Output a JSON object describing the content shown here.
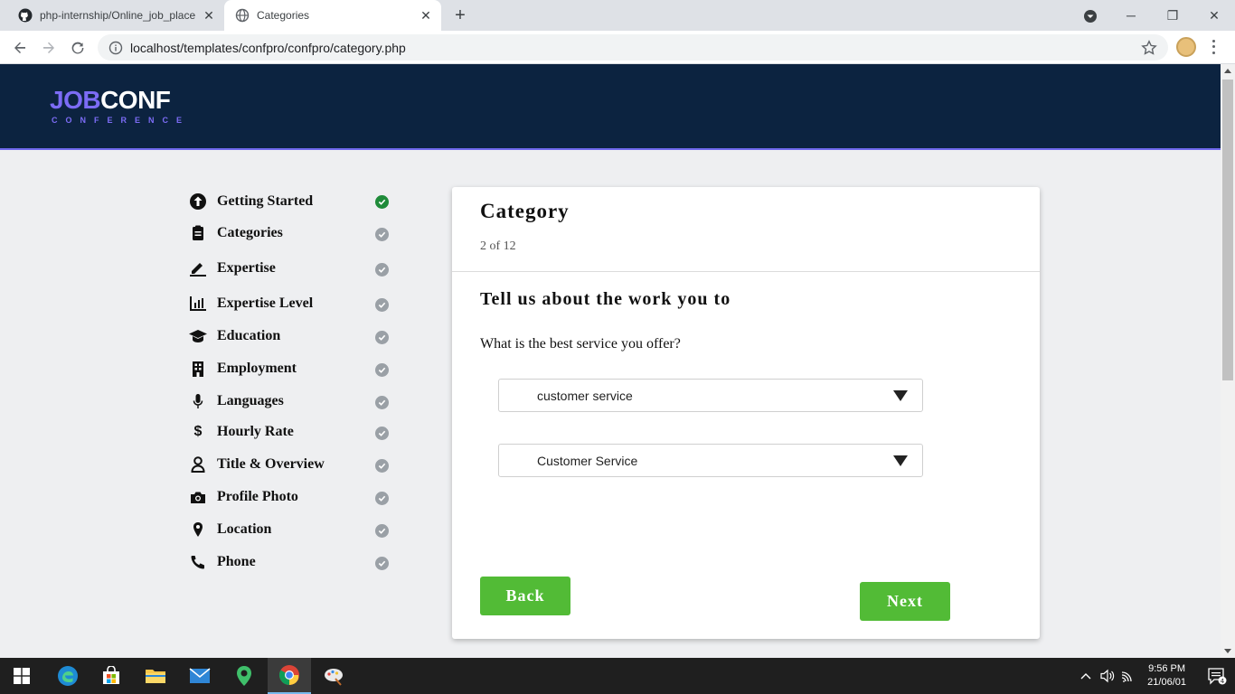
{
  "browser": {
    "tabs": [
      {
        "title": "php-internship/Online_job_place",
        "icon": "github-icon",
        "active": false
      },
      {
        "title": "Categories",
        "icon": "globe-icon",
        "active": true
      }
    ],
    "url": "localhost/templates/confpro/confpro/category.php"
  },
  "site": {
    "logo_main_part1": "JOB",
    "logo_main_part2": "CONF",
    "logo_sub": "CONFERENCE",
    "header_color": "#0c2340",
    "accent_color": "#7c6cf5"
  },
  "steps": [
    {
      "label": "Getting Started",
      "icon": "arrow-up-circle-icon",
      "done": true
    },
    {
      "label": "Categories",
      "icon": "clipboard-icon",
      "done": false
    },
    {
      "label": "Expertise",
      "icon": "pencil-icon",
      "done": false
    },
    {
      "label": "Expertise Level",
      "icon": "bar-chart-icon",
      "done": false
    },
    {
      "label": "Education",
      "icon": "graduation-cap-icon",
      "done": false
    },
    {
      "label": "Employment",
      "icon": "building-icon",
      "done": false
    },
    {
      "label": "Languages",
      "icon": "microphone-icon",
      "done": false
    },
    {
      "label": "Hourly Rate",
      "icon": "dollar-icon",
      "done": false
    },
    {
      "label": "Title & Overview",
      "icon": "user-icon",
      "done": false
    },
    {
      "label": "Profile Photo",
      "icon": "camera-icon",
      "done": false
    },
    {
      "label": "Location",
      "icon": "map-pin-icon",
      "done": false
    },
    {
      "label": "Phone",
      "icon": "phone-icon",
      "done": false
    }
  ],
  "card": {
    "title": "Category",
    "progress": "2 of 12",
    "heading": "Tell us about the work you to",
    "question": "What is the best service you offer?",
    "select1_value": "customer service",
    "select2_value": "Customer Service",
    "back_label": "Back",
    "next_label": "Next",
    "button_color": "#52bb36"
  },
  "taskbar": {
    "time": "9:56 PM",
    "date": "21/06/01",
    "notifications": "4"
  }
}
